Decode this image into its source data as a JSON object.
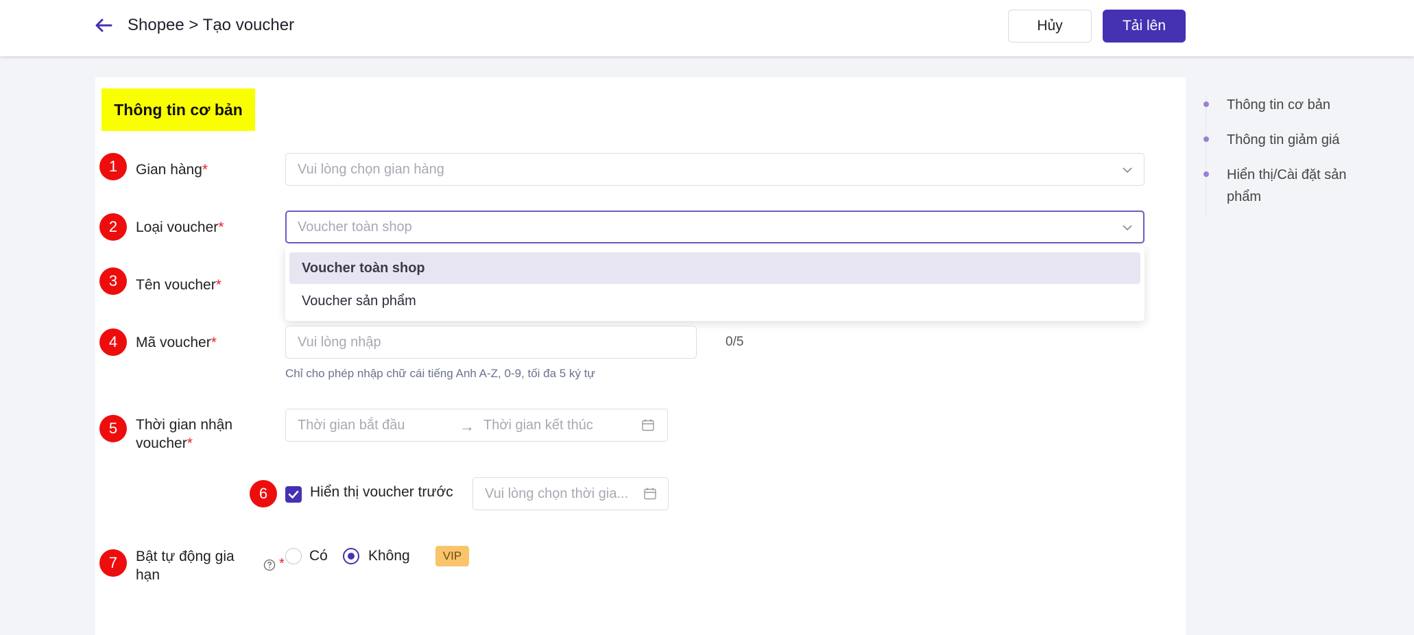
{
  "header": {
    "breadcrumb": "Shopee > Tạo voucher",
    "cancel_label": "Hủy",
    "upload_label": "Tải lên"
  },
  "section": {
    "title": "Thông tin cơ bản"
  },
  "steps": [
    "1",
    "2",
    "3",
    "4",
    "5",
    "6",
    "7"
  ],
  "form": {
    "store": {
      "label": "Gian hàng",
      "required": "*",
      "placeholder": "Vui lòng chọn gian hàng"
    },
    "voucher_type": {
      "label": "Loại voucher",
      "required": "*",
      "placeholder": "Voucher toàn shop",
      "options": [
        "Voucher toàn shop",
        "Voucher sản phẩm"
      ],
      "highlighted_option": "Voucher toàn shop"
    },
    "voucher_name": {
      "label": "Tên voucher",
      "required": "*"
    },
    "voucher_code": {
      "label": "Mã voucher",
      "required": "*",
      "placeholder": "Vui lòng nhập",
      "counter": "0/5",
      "hint": "Chỉ cho phép nhập chữ cái tiếng Anh A-Z, 0-9, tối đa 5 ký tự"
    },
    "receive_time": {
      "label_line1": "Thời gian nhận",
      "label_line2": "voucher",
      "required": "*",
      "start_placeholder": "Thời gian bắt đầu",
      "arrow": "→",
      "end_placeholder": "Thời gian kết thúc"
    },
    "show_before": {
      "checked": true,
      "label": "Hiển thị voucher trước",
      "placeholder": "Vui lòng chọn thời gia..."
    },
    "auto_renew": {
      "label_line1": "Bật tự động gia",
      "label_line2": "hạn",
      "required": "*",
      "option_yes": "Có",
      "option_no": "Không",
      "selected": "Không",
      "badge": "VIP"
    }
  },
  "side_nav": {
    "items": [
      "Thông tin cơ bản",
      "Thông tin giảm giá",
      "Hiển thị/Cài đặt sản phẩm"
    ]
  },
  "colors": {
    "primary": "#4432b3",
    "highlight": "#faff00",
    "badge": "#ee0d0d",
    "required": "#e5212b",
    "vip": "#f9c46a"
  }
}
